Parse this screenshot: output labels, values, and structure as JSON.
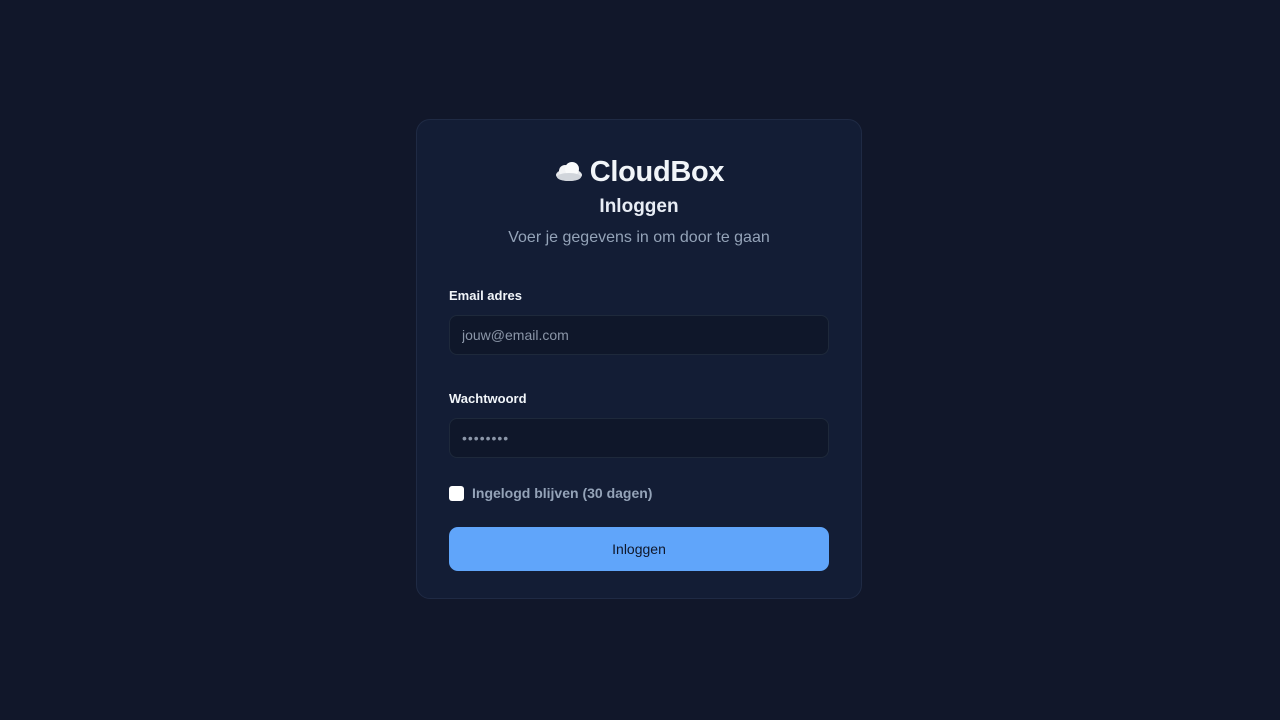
{
  "brand": {
    "icon": "cloud-icon",
    "name": "CloudBox"
  },
  "form": {
    "title": "Inloggen",
    "subtitle": "Voer je gegevens in om door te gaan",
    "email": {
      "label": "Email adres",
      "placeholder": "jouw@email.com",
      "value": ""
    },
    "password": {
      "label": "Wachtwoord",
      "placeholder": "••••••••",
      "value": ""
    },
    "remember": {
      "label": "Ingelogd blijven (30 dagen)",
      "checked": false
    },
    "submit_label": "Inloggen"
  },
  "colors": {
    "background": "#11172a",
    "card": "#131d35",
    "input": "#0f172a",
    "accent": "#60a5fa",
    "muted_text": "#94a3b8"
  }
}
